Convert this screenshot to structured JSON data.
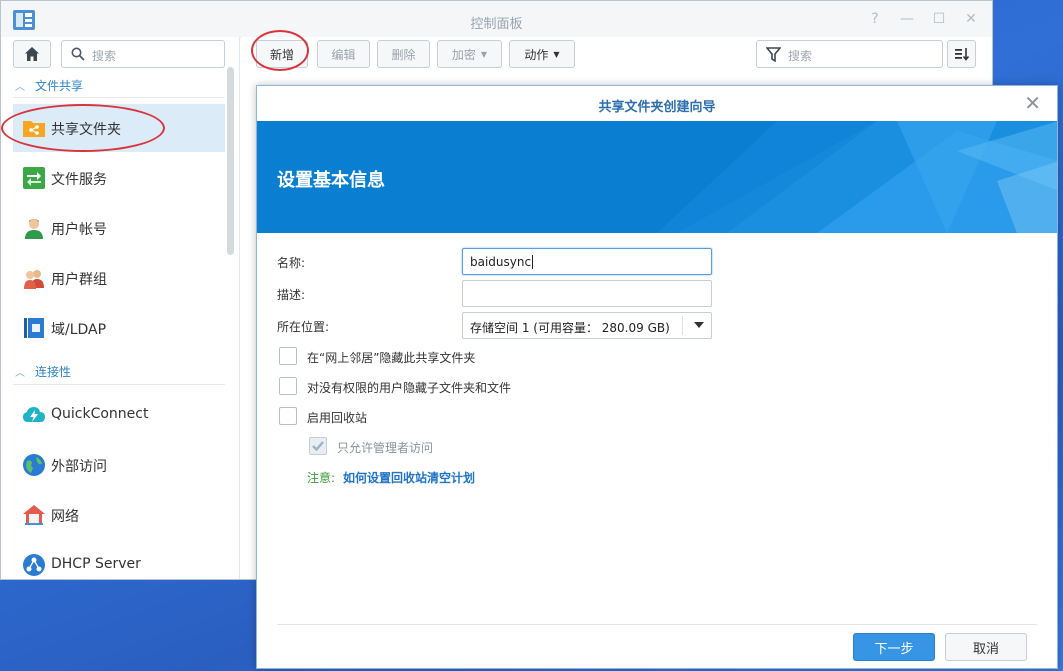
{
  "window": {
    "title": "控制面板",
    "controls": [
      "?",
      "—",
      "☐",
      "✕"
    ]
  },
  "sidebar": {
    "search_placeholder": "搜索",
    "sections": [
      {
        "title": "文件共享"
      },
      {
        "title": "连接性"
      }
    ],
    "items": [
      {
        "label": "共享文件夹",
        "icon": "shared-folder-icon",
        "active": true
      },
      {
        "label": "文件服务",
        "icon": "file-services-icon"
      },
      {
        "label": "用户帐号",
        "icon": "user-icon"
      },
      {
        "label": "用户群组",
        "icon": "group-icon"
      },
      {
        "label": "域/LDAP",
        "icon": "domain-ldap-icon"
      },
      {
        "label": "QuickConnect",
        "icon": "quickconnect-icon"
      },
      {
        "label": "外部访问",
        "icon": "external-access-icon"
      },
      {
        "label": "网络",
        "icon": "network-icon"
      },
      {
        "label": "DHCP Server",
        "icon": "dhcp-server-icon"
      }
    ]
  },
  "toolbar": {
    "create": "新增",
    "edit": "编辑",
    "delete": "删除",
    "encrypt": "加密",
    "action": "动作",
    "search_placeholder": "搜索"
  },
  "dialog": {
    "title": "共享文件夹创建向导",
    "banner_heading": "设置基本信息",
    "fields": {
      "name_label": "名称:",
      "name_value": "baidusync",
      "desc_label": "描述:",
      "desc_value": "",
      "location_label": "所在位置:",
      "location_value": "存储空间 1 (可用容量： 280.09 GB)"
    },
    "checkboxes": [
      {
        "label": "在“网上邻居”隐藏此共享文件夹",
        "checked": false
      },
      {
        "label": "对没有权限的用户隐藏子文件夹和文件",
        "checked": false
      },
      {
        "label": "启用回收站",
        "checked": false
      },
      {
        "label": "只允许管理者访问",
        "checked": true,
        "disabled": true
      }
    ],
    "note_label": "注意:",
    "note_link": "如何设置回收站清空计划",
    "next_button": "下一步",
    "cancel_button": "取消"
  },
  "colors": {
    "accent": "#3795e6",
    "banner": "#0d82d4",
    "highlight_ring": "#d9343d",
    "active_item_bg": "#dcebf8"
  }
}
